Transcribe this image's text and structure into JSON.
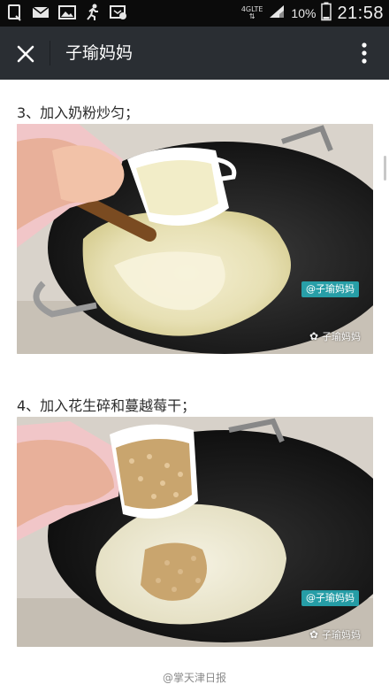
{
  "status_bar": {
    "network_type": "4GLTE",
    "battery_percent": "10%",
    "time": "21:58",
    "icons": [
      "sim-icon",
      "mail-icon",
      "gallery-icon",
      "run-icon",
      "app-notification-icon"
    ]
  },
  "app_bar": {
    "title": "子瑜妈妈",
    "close_icon": "close-icon",
    "more_icon": "more-vertical-icon"
  },
  "article": {
    "steps": [
      {
        "text": "3、加入奶粉炒匀；",
        "watermark_tag": "@子瑜妈妈",
        "watermark_brand": "子瑜妈妈"
      },
      {
        "text": "4、加入花生碎和蔓越莓干；",
        "watermark_tag": "@子瑜妈妈",
        "watermark_brand": "子瑜妈妈"
      }
    ],
    "footer_watermark": "@掌天津日报"
  },
  "colors": {
    "status_bar_bg": "#0b0b0b",
    "app_bar_bg": "#2a2e33",
    "watermark_tag_bg": "#28b4be"
  }
}
